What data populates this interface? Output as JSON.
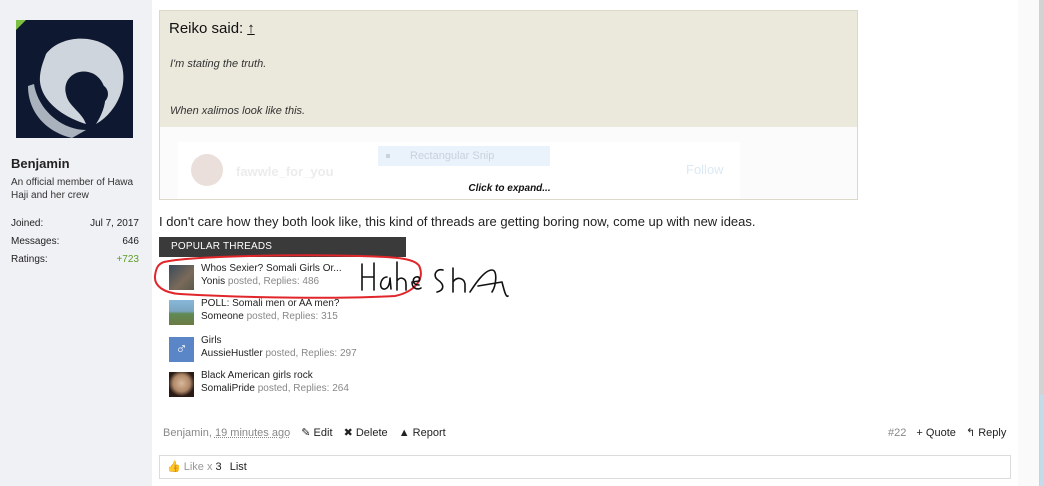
{
  "colors": {
    "accent_green": "#5a9e26",
    "dark_header": "#3a3a3a",
    "quote_bg": "#ebe8dc",
    "annotation_red": "#e0262a"
  },
  "user": {
    "name": "Benjamin",
    "title": "An official member of Hawa Haji and her crew",
    "stats": [
      {
        "label": "Joined:",
        "value": "Jul 7, 2017"
      },
      {
        "label": "Messages:",
        "value": "646"
      },
      {
        "label": "Ratings:",
        "value": "+723"
      }
    ]
  },
  "quote": {
    "author": "Reiko said:",
    "arrow": "↑",
    "line1": "I'm stating the truth.",
    "line2": "When xalimos look like this.",
    "embed": {
      "name": "fawwle_for_you",
      "snip_label": "Rectangular Snip",
      "follow_label": "Follow"
    },
    "expand_label": "Click to expand..."
  },
  "message_text": "I don't care how they both look like, this kind of threads are getting boring now, come up with new ideas.",
  "popular": {
    "header": "POPULAR THREADS",
    "threads": [
      {
        "title": "Whos Sexier? Somali Girls Or...",
        "author": "Yonis",
        "meta": "posted, Replies: 486",
        "thumb_icon": "photo-icon"
      },
      {
        "title": "POLL: Somali men or AA men?",
        "author": "Someone",
        "meta": "posted, Replies: 315",
        "thumb_icon": "landscape-icon"
      },
      {
        "title": "Girls",
        "author": "AussieHustler",
        "meta": "posted, Replies: 297",
        "thumb_icon": "male-symbol-icon"
      },
      {
        "title": "Black American girls rock",
        "author": "SomaliPride",
        "meta": "posted, Replies: 264",
        "thumb_icon": "face-icon"
      }
    ]
  },
  "annotation": {
    "text": "Haha Sha"
  },
  "footer": {
    "author": "Benjamin,",
    "timestamp": "19 minutes ago",
    "edit": "Edit",
    "delete": "Delete",
    "report": "Report",
    "post_number": "#22",
    "quote": "+ Quote",
    "reply": "Reply"
  },
  "likes": {
    "prefix": "Like x",
    "count": "3",
    "list_label": "List"
  }
}
